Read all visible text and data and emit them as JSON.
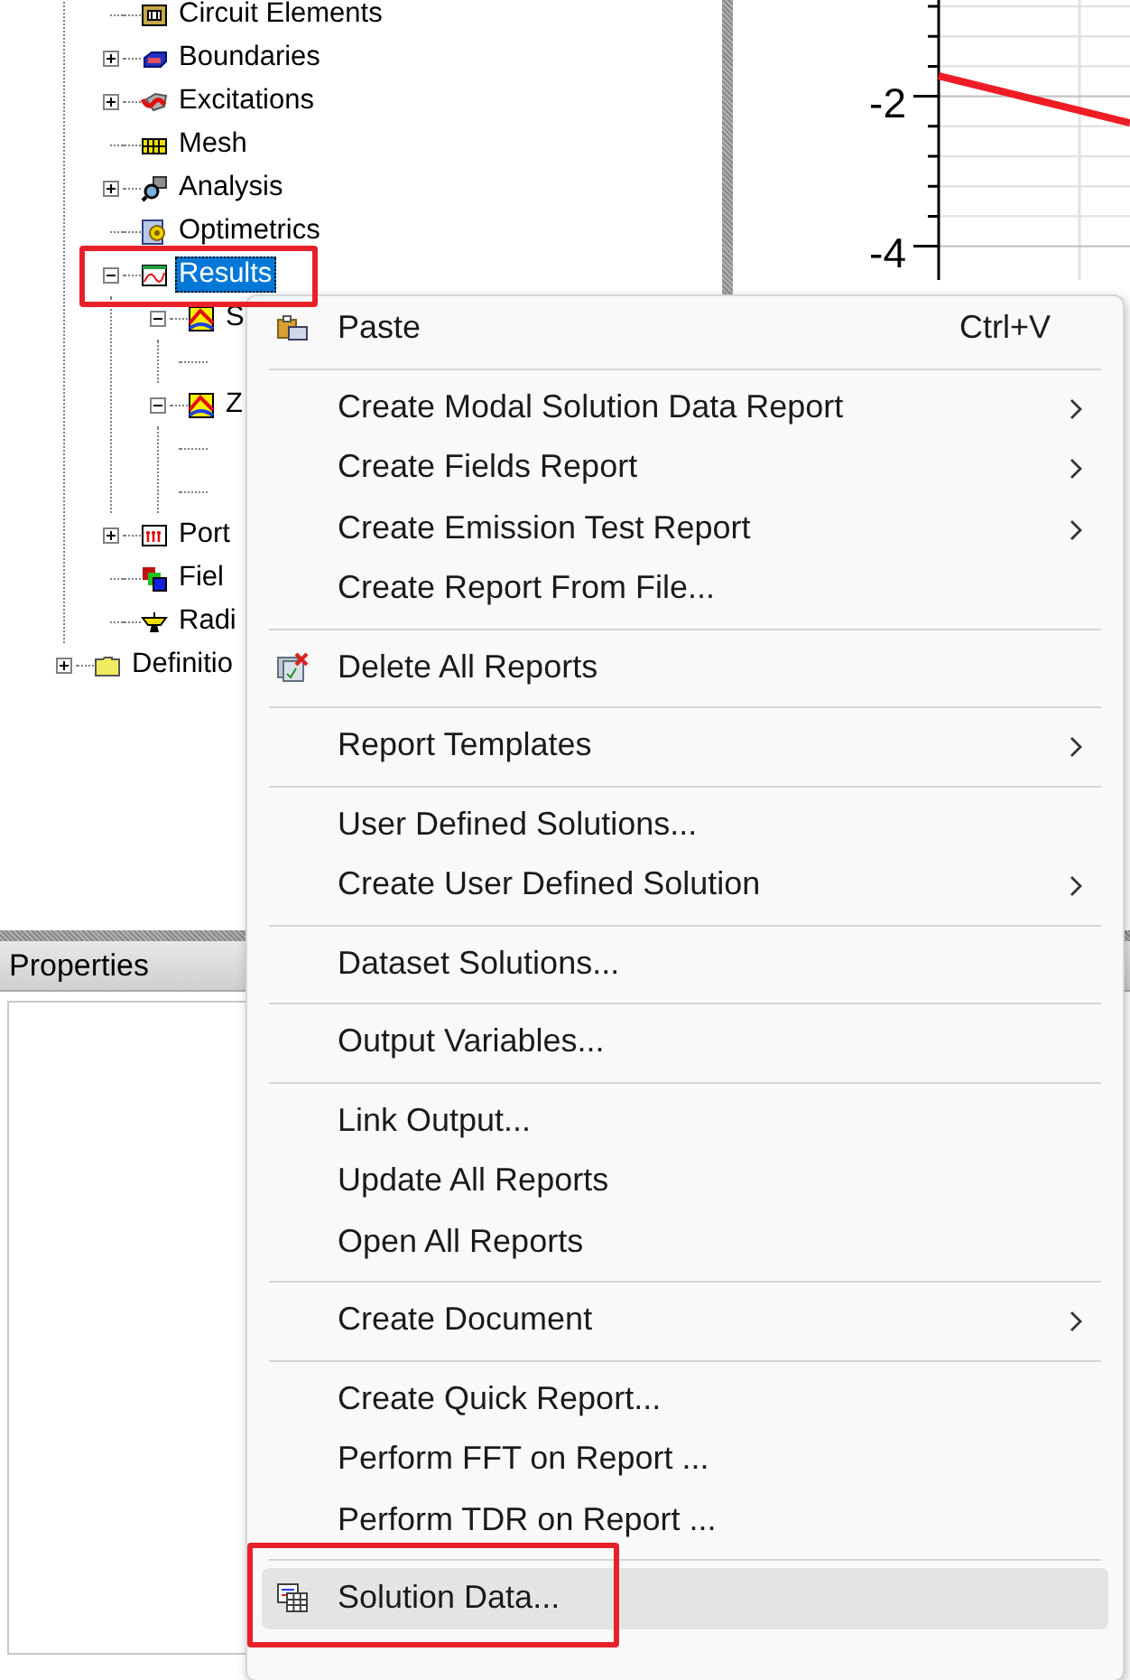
{
  "tree": {
    "items": [
      {
        "kind": "group",
        "children": [
          {
            "label": "Circuit Elements",
            "kind": "circuit",
            "selected": false
          },
          {
            "label": "Boundaries",
            "kind": "boundary",
            "expanded": false,
            "selected": false
          },
          {
            "label": "Excitations",
            "kind": "excitation",
            "expanded": false,
            "selected": false
          },
          {
            "label": "Mesh",
            "kind": "mesh",
            "selected": false
          },
          {
            "label": "Analysis",
            "kind": "analysis",
            "expanded": false,
            "selected": false
          },
          {
            "label": "Optimetrics",
            "kind": "optimetrics",
            "selected": false
          },
          {
            "label": "Results",
            "kind": "results",
            "expanded": true,
            "selected": true,
            "highlighted": true,
            "children": [
              {
                "label": "S",
                "kind": "solution",
                "expanded": true,
                "selected": false,
                "children": [
                  {
                    "kind": "leaf"
                  }
                ]
              },
              {
                "label": "Z",
                "kind": "solution",
                "expanded": true,
                "selected": false,
                "children": [
                  {
                    "kind": "leaf"
                  },
                  {
                    "kind": "leaf"
                  }
                ]
              }
            ]
          },
          {
            "label": "Port",
            "kind": "port",
            "expanded": false,
            "selected": false
          },
          {
            "label": "Fiel",
            "kind": "field",
            "selected": false
          },
          {
            "label": "Radi",
            "kind": "radiation",
            "selected": false
          }
        ]
      },
      {
        "label": "Definitio",
        "kind": "folder",
        "expanded": false,
        "selected": false
      }
    ]
  },
  "plot": {
    "tick_labels": [
      "-2",
      "-4"
    ]
  },
  "properties": {
    "title": "Properties"
  },
  "context_menu": {
    "items": [
      {
        "kind": "paste",
        "label": "Paste",
        "shortcut": "Ctrl+V",
        "submenu": false,
        "selected": false
      },
      {
        "kind": "separator"
      },
      {
        "kind": "item",
        "label": "Create Modal Solution Data Report",
        "submenu": true,
        "selected": false
      },
      {
        "kind": "item",
        "label": "Create Fields Report",
        "submenu": true,
        "selected": false
      },
      {
        "kind": "item",
        "label": "Create Emission Test Report",
        "submenu": true,
        "selected": false
      },
      {
        "kind": "item",
        "label": "Create Report From File...",
        "submenu": false,
        "selected": false
      },
      {
        "kind": "separator"
      },
      {
        "kind": "delete",
        "label": "Delete All Reports",
        "submenu": false,
        "selected": false
      },
      {
        "kind": "separator"
      },
      {
        "kind": "item",
        "label": "Report Templates",
        "submenu": true,
        "selected": false
      },
      {
        "kind": "separator"
      },
      {
        "kind": "item",
        "label": "User Defined Solutions...",
        "submenu": false,
        "selected": false
      },
      {
        "kind": "item",
        "label": "Create User Defined Solution",
        "submenu": true,
        "selected": false
      },
      {
        "kind": "separator"
      },
      {
        "kind": "item",
        "label": "Dataset Solutions...",
        "submenu": false,
        "selected": false
      },
      {
        "kind": "separator"
      },
      {
        "kind": "item",
        "label": "Output Variables...",
        "submenu": false,
        "selected": false
      },
      {
        "kind": "separator"
      },
      {
        "kind": "item",
        "label": "Link Output...",
        "submenu": false,
        "selected": false
      },
      {
        "kind": "item",
        "label": "Update All Reports",
        "submenu": false,
        "selected": false
      },
      {
        "kind": "item",
        "label": "Open All Reports",
        "submenu": false,
        "selected": false
      },
      {
        "kind": "separator"
      },
      {
        "kind": "item",
        "label": "Create Document",
        "submenu": true,
        "selected": false
      },
      {
        "kind": "separator"
      },
      {
        "kind": "item",
        "label": "Create Quick Report...",
        "submenu": false,
        "selected": false
      },
      {
        "kind": "item",
        "label": "Perform FFT on Report ...",
        "submenu": false,
        "selected": false
      },
      {
        "kind": "item",
        "label": "Perform TDR on Report ...",
        "submenu": false,
        "selected": false
      },
      {
        "kind": "separator"
      },
      {
        "kind": "data",
        "label": "Solution Data...",
        "submenu": false,
        "selected": true,
        "highlighted": true
      }
    ]
  }
}
